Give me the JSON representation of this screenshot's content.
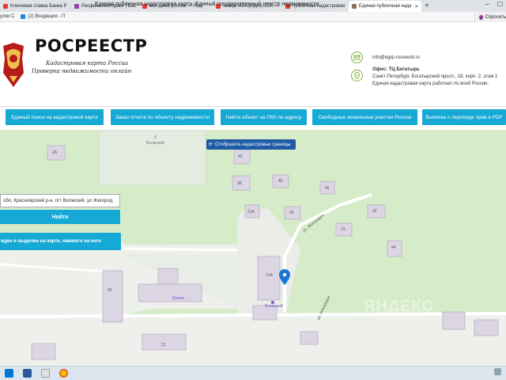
{
  "browser": {
    "tabs": [
      {
        "label": "Ключевая ставка Банка Р",
        "color": "#e53935"
      },
      {
        "label": "Росфинмониторинг | Вас",
        "color": "#8e44ad"
      },
      {
        "label": "все дома россии — Янд",
        "color": "#e53935"
      },
      {
        "label": "Улица Жигородок, 21А —",
        "color": "#e53935"
      },
      {
        "label": "публичная кадастровая",
        "color": "#e53935"
      },
      {
        "label": "Единая публичная када",
        "color": "#8d6e63"
      }
    ],
    "active_tab_index": 5,
    "new_tab_symbol": "+",
    "window_title": "Единая публичная кадастровая карта: Единый государственный реестр недвижимости",
    "bookmarks": [
      {
        "label": "улки С",
        "color": "#4caf50"
      },
      {
        "label": "(2) Входящие - П",
        "color": "#1e88e5"
      }
    ],
    "ask_label": "Спросить"
  },
  "header": {
    "logo_title": "РОСРЕЕСТР",
    "logo_line1": "Кадастровая карта России",
    "logo_line2": "Проверка недвижимости онлайн",
    "email": "info@egrp-rosreestr.ru",
    "office_label": "Офис: ТЦ Богатырь",
    "address": "Санкт-Петербург, Богатырский просп., 18, корп. 2, этаж 1",
    "note": "Единая кадастровая карта работает по всей России.",
    "accent_color": "#7fb342"
  },
  "nav": {
    "buttons": [
      "Единый поиск на кадастровой карте",
      "Заказ отчета по объекту недвижимости",
      "Найти объект на ПКК по адресу",
      "Свободные земельные участки России",
      "Выписка о переходе прав в PDF"
    ],
    "color": "#16a9d6"
  },
  "map": {
    "show_borders_label": "Отобразить кадастровые границы",
    "address_value": "обл, Красноярский р-н, пгт Волжский, ул Жигород",
    "find_label": "Найти",
    "hint_text": "иден и выделен на карте, нажмите на него",
    "building_numbers": [
      "2А",
      "40",
      "38",
      "46",
      "42",
      "32",
      "21А",
      "30",
      "31",
      "44",
      "21А",
      "26",
      "21",
      "2"
    ],
    "place_labels": [
      "Волжский",
      "Школа",
      "Волжский"
    ],
    "street_labels": [
      "ул. Жигородок",
      "ул. Жигородок"
    ],
    "watermark": "ЯНДЕКС"
  }
}
